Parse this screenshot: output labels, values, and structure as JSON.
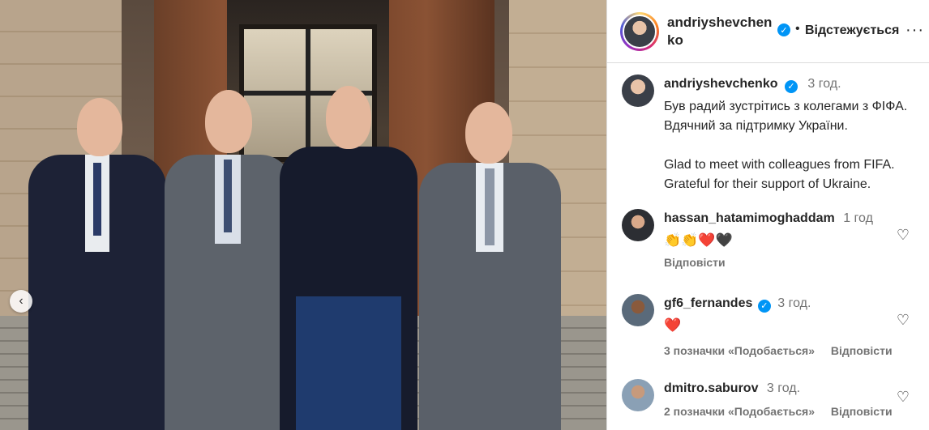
{
  "post": {
    "author": "andriyshevchenko",
    "verified_icon": "verified-badge-icon",
    "follow_status": "Відстежується",
    "caption_time": "3 год.",
    "caption_text": "Був радий зустрітись з колегами з ФІФА. Вдячний за підтримку України.\n\nGlad to meet with colleagues from FIFA. Grateful for their support of Ukraine."
  },
  "comments": [
    {
      "user": "hassan_hatamimoghaddam",
      "time": "1 год",
      "verified": false,
      "text": "👏👏❤️🖤",
      "likes": "",
      "reply": "Відповісти"
    },
    {
      "user": "gf6_fernandes",
      "time": "3 год.",
      "verified": true,
      "text": "❤️",
      "likes": "3 позначки «Подобається»",
      "reply": "Відповісти"
    },
    {
      "user": "dmitro.saburov",
      "time": "3 год.",
      "verified": false,
      "text": "",
      "likes": "2 позначки «Подобається»",
      "reply": "Відповісти"
    }
  ],
  "icons": {
    "carousel_prev": "chevron-left-icon",
    "more": "more-options-icon",
    "like": "heart-outline-icon"
  },
  "colors": {
    "verified": "#0095f6",
    "muted": "#737373"
  }
}
